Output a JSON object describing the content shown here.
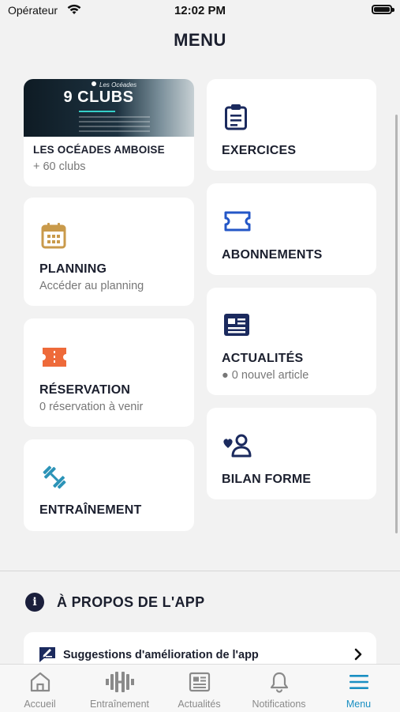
{
  "status_bar": {
    "carrier": "Opérateur",
    "time": "12:02 PM"
  },
  "page": {
    "title": "MENU"
  },
  "colors": {
    "navy": "#1b2a5e",
    "gold": "#c99a4b",
    "orange": "#ee6a3a",
    "teal": "#2b93b7",
    "blue": "#2457c7",
    "active_tab": "#1a8fc2"
  },
  "club_card": {
    "banner_brand": "Les Océades",
    "banner_title": "9 CLUBS",
    "title": "LES OCÉADES AMBOISE",
    "subtitle": "+ 60 clubs"
  },
  "cards": {
    "planning": {
      "title": "PLANNING",
      "subtitle": "Accéder au planning",
      "icon": "calendar-icon"
    },
    "reservation": {
      "title": "RÉSERVATION",
      "subtitle": "0 réservation à venir",
      "icon": "ticket-icon"
    },
    "entrainement": {
      "title": "ENTRAÎNEMENT",
      "icon": "dumbbell-icon"
    },
    "exercices": {
      "title": "EXERCICES",
      "icon": "clipboard-icon"
    },
    "abonnements": {
      "title": "ABONNEMENTS",
      "icon": "pass-icon"
    },
    "actualites": {
      "title": "ACTUALITÉS",
      "subtitle": "● 0 nouvel article",
      "icon": "newspaper-icon"
    },
    "bilan": {
      "title": "BILAN FORME",
      "icon": "heart-person-icon"
    }
  },
  "about": {
    "title": "À PROPOS DE L'APP",
    "info_glyph": "i",
    "suggestions_label": "Suggestions d'amélioration de l'app"
  },
  "tabbar": {
    "items": [
      {
        "label": "Accueil",
        "icon": "home-icon"
      },
      {
        "label": "Entraînement",
        "icon": "barbell-icon"
      },
      {
        "label": "Actualités",
        "icon": "newspaper-icon"
      },
      {
        "label": "Notifications",
        "icon": "bell-icon"
      },
      {
        "label": "Menu",
        "icon": "menu-icon",
        "active": true
      }
    ]
  }
}
